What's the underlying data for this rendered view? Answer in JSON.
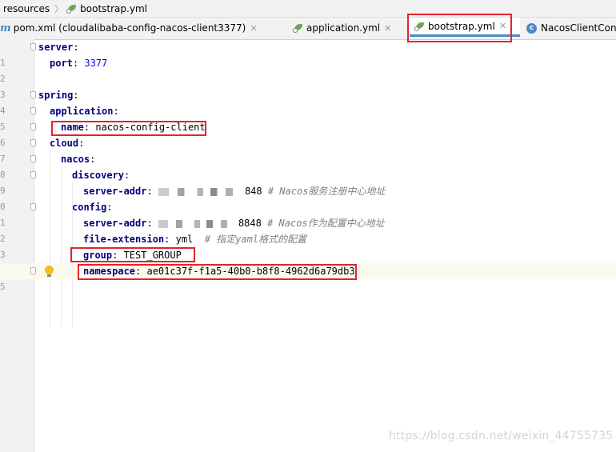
{
  "breadcrumb": {
    "items": [
      "resources",
      "bootstrap.yml"
    ]
  },
  "tabs": [
    {
      "label": "pom.xml (cloudalibaba-config-nacos-client3377)",
      "icon": "maven-icon",
      "active": false
    },
    {
      "label": "application.yml",
      "icon": "yaml-icon",
      "active": false
    },
    {
      "label": "bootstrap.yml",
      "icon": "yaml-icon",
      "active": true
    },
    {
      "label": "NacosClientCon",
      "icon": "class-icon",
      "active": false
    }
  ],
  "editor": {
    "line_numbers": [
      "1",
      "2",
      "3",
      "4",
      "4",
      "5",
      "6",
      "7",
      "8",
      "9",
      "0",
      "1",
      "2",
      "3",
      "4",
      "5"
    ],
    "lines": [
      {
        "key": "server",
        "value": ""
      },
      {
        "key": "port",
        "value": "3377"
      },
      {
        "key": "",
        "value": ""
      },
      {
        "key": "spring",
        "value": ""
      },
      {
        "key": "application",
        "value": ""
      },
      {
        "key": "name",
        "value": "nacos-config-client"
      },
      {
        "key": "cloud",
        "value": ""
      },
      {
        "key": "nacos",
        "value": ""
      },
      {
        "key": "discovery",
        "value": ""
      },
      {
        "key": "server-addr",
        "value": "848",
        "comment": "# Nacos服务注册中心地址"
      },
      {
        "key": "config",
        "value": ""
      },
      {
        "key": "server-addr",
        "value": "8848",
        "comment": "# Nacos作为配置中心地址"
      },
      {
        "key": "file-extension",
        "value": "yml",
        "comment": "# 指定yaml格式的配置"
      },
      {
        "key": "group",
        "value": "TEST_GROUP"
      },
      {
        "key": "namespace",
        "value": "ae01c37f-f1a5-40b0-b8f8-4962d6a79db3"
      }
    ]
  },
  "watermark": "https://blog.csdn.net/weixin_44755735",
  "colors": {
    "highlight_box": "#e0242c",
    "yaml_key": "#000080",
    "number": "#0000ff",
    "comment": "#808080",
    "active_tab_underline": "#4a88c7"
  }
}
